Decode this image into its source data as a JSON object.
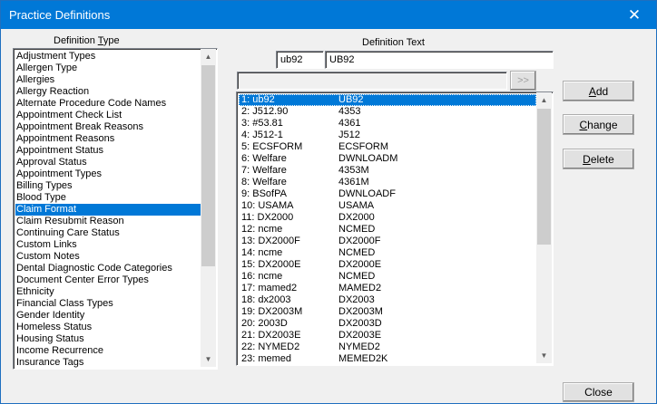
{
  "window": {
    "title": "Practice Definitions",
    "close_glyph": "✕"
  },
  "left": {
    "label_pre": "Definition ",
    "label_u": "T",
    "label_post": "ype",
    "items": [
      "Adjustment Types",
      "Allergen Type",
      "Allergies",
      "Allergy Reaction",
      "Alternate Procedure Code Names",
      "Appointment Check List",
      "Appointment Break Reasons",
      "Appointment Reasons",
      "Appointment Status",
      "Approval Status",
      "Appointment Types",
      "Billing Types",
      "Blood Type",
      "Claim Format",
      "Claim Resubmit Reason",
      "Continuing Care Status",
      "Custom Links",
      "Custom Notes",
      "Dental Diagnostic Code Categories",
      "Document Center Error Types",
      "Ethnicity",
      "Financial Class Types",
      "Gender Identity",
      "Homeless Status",
      "Housing Status",
      "Income Recurrence",
      "Insurance Tags"
    ],
    "selected_index": 13
  },
  "def_text": {
    "label": "Definition Text",
    "code_value": "ub92",
    "text_value": "UB92",
    "arrow_button": ">>"
  },
  "right_list": {
    "items": [
      [
        "1: ub92",
        "UB92"
      ],
      [
        "2: J512.90",
        "4353"
      ],
      [
        "3: #53.81",
        "4361"
      ],
      [
        "4: J512-1",
        "J512"
      ],
      [
        "5: ECSFORM",
        "ECSFORM"
      ],
      [
        "6: Welfare",
        "DWNLOADM"
      ],
      [
        "7: Welfare",
        "4353M"
      ],
      [
        "8: Welfare",
        "4361M"
      ],
      [
        "9: BSofPA",
        "DWNLOADF"
      ],
      [
        "10: USAMA",
        "USAMA"
      ],
      [
        "11: DX2000",
        "DX2000"
      ],
      [
        "12: ncme",
        "NCMED"
      ],
      [
        "13: DX2000F",
        "DX2000F"
      ],
      [
        "14: ncme",
        "NCMED"
      ],
      [
        "15: DX2000E",
        "DX2000E"
      ],
      [
        "16: ncme",
        "NCMED"
      ],
      [
        "17: mamed2",
        "MAMED2"
      ],
      [
        "18: dx2003",
        "DX2003"
      ],
      [
        "19: DX2003M",
        "DX2003M"
      ],
      [
        "20: 2003D",
        "DX2003D"
      ],
      [
        "21: DX2003E",
        "DX2003E"
      ],
      [
        "22: NYMED2",
        "NYMED2"
      ],
      [
        "23: memed",
        "MEMED2K"
      ]
    ],
    "selected_index": 0
  },
  "buttons": {
    "add_u": "A",
    "add_rest": "dd",
    "change_u": "C",
    "change_rest": "hange",
    "delete_u": "D",
    "delete_rest": "elete",
    "close": "Close"
  },
  "icons": {
    "scroll_up": "▲",
    "scroll_down": "▼"
  }
}
